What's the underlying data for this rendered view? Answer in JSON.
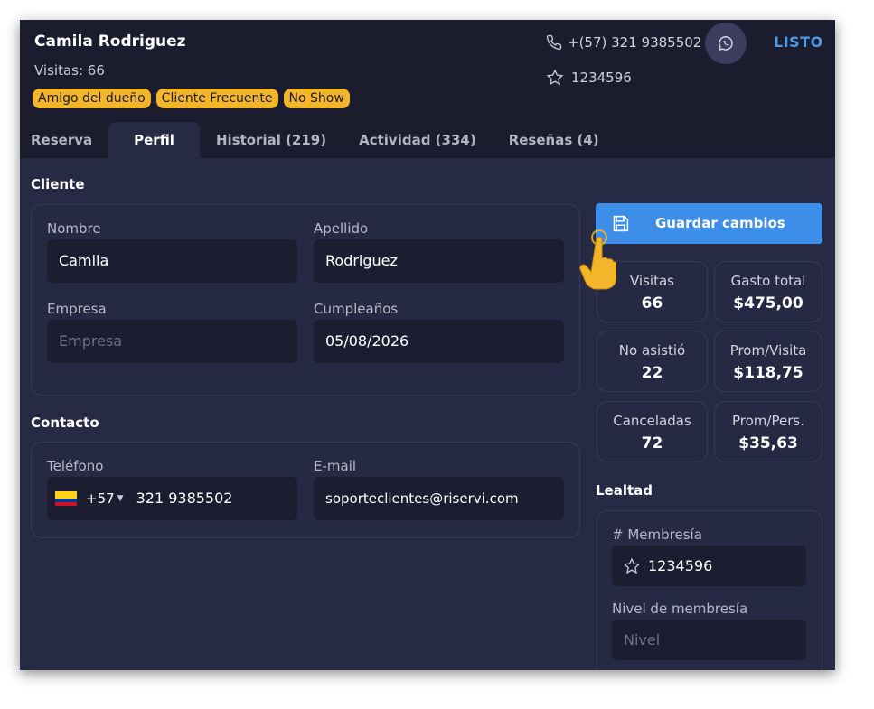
{
  "header": {
    "name": "Camila Rodriguez",
    "visits": "Visitas: 66",
    "tags": [
      "Amigo del dueño",
      "Cliente Frecuente",
      "No Show"
    ],
    "phone": "+(57) 321 9385502",
    "membership": "1234596",
    "done_label": "LISTO",
    "whatsapp_icon": "whatsapp-icon"
  },
  "tabs": [
    {
      "label": "Reserva"
    },
    {
      "label": "Perfil",
      "active": true
    },
    {
      "label": "Historial (219)"
    },
    {
      "label": "Actividad (334)"
    },
    {
      "label": "Reseñas (4)"
    }
  ],
  "cliente": {
    "title": "Cliente",
    "nombre_label": "Nombre",
    "nombre_value": "Camila",
    "apellido_label": "Apellido",
    "apellido_value": "Rodriguez",
    "empresa_label": "Empresa",
    "empresa_placeholder": "Empresa",
    "cumple_label": "Cumpleaños",
    "cumple_value": "05/08/2026"
  },
  "contacto": {
    "title": "Contacto",
    "telefono_label": "Teléfono",
    "country_code": "+57",
    "telefono_value": "321 9385502",
    "email_label": "E-mail",
    "email_value": "soporteclientes@riservi.com"
  },
  "save_label": "Guardar cambios",
  "stats": [
    {
      "label": "Visitas",
      "value": "66"
    },
    {
      "label": "Gasto total",
      "value": "$475,00"
    },
    {
      "label": "No asistió",
      "value": "22"
    },
    {
      "label": "Prom/Visita",
      "value": "$118,75"
    },
    {
      "label": "Canceladas",
      "value": "72"
    },
    {
      "label": "Prom/Pers.",
      "value": "$35,63"
    }
  ],
  "lealtad": {
    "title": "Lealtad",
    "membresia_label": "# Membresía",
    "membresia_value": "1234596",
    "nivel_label": "Nivel de membresía",
    "nivel_placeholder": "Nivel"
  },
  "colors": {
    "background": "#272a45",
    "header": "#1b1c2e",
    "input": "#1c1d31",
    "accent": "#3c8ee8",
    "tag": "#f4b629",
    "done": "#4d9be8"
  }
}
